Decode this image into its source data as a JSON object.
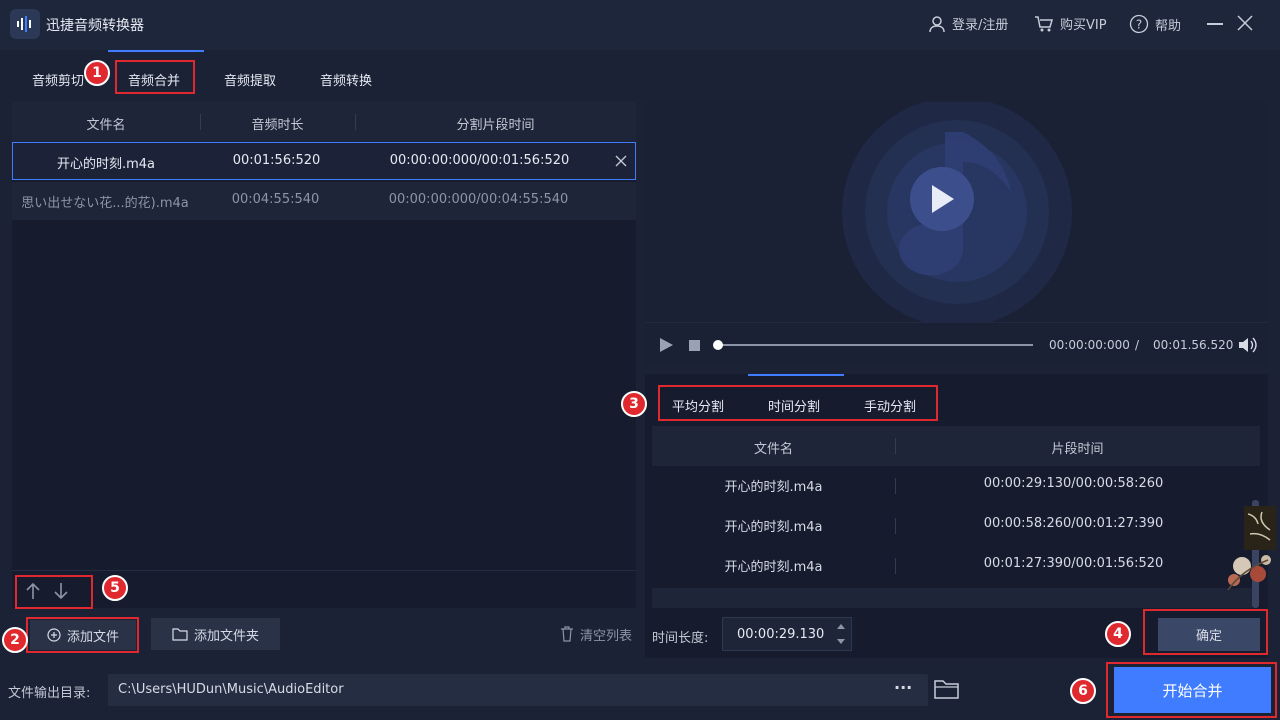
{
  "app": {
    "title": "迅捷音频转换器"
  },
  "titlebar": {
    "login": "登录/注册",
    "vip": "购买VIP",
    "help": "帮助"
  },
  "tabs": [
    "音频剪切",
    "音频合并",
    "音频提取",
    "音频转换"
  ],
  "file_table": {
    "columns": [
      "文件名",
      "音频时长",
      "分割片段时间"
    ],
    "rows": [
      {
        "name": "开心的时刻.m4a",
        "duration": "00:01:56:520",
        "range": "00:00:00:000/00:01:56:520"
      },
      {
        "name": "思い出せない花...的花).m4a",
        "duration": "00:04:55:540",
        "range": "00:00:00:000/00:04:55:540"
      }
    ]
  },
  "left_buttons": {
    "add_file": "添加文件",
    "add_folder": "添加文件夹",
    "clear_list": "清空列表"
  },
  "player": {
    "current_time": "00:00:00:000",
    "separator": "/",
    "total_time": "00:01.56.520"
  },
  "split_tabs": [
    "平均分割",
    "时间分割",
    "手动分割"
  ],
  "split_table": {
    "columns": [
      "文件名",
      "片段时间"
    ],
    "rows": [
      {
        "name": "开心的时刻.m4a",
        "time": "00:00:29:130/00:00:58:260"
      },
      {
        "name": "开心的时刻.m4a",
        "time": "00:00:58:260/00:01:27:390"
      },
      {
        "name": "开心的时刻.m4a",
        "time": "00:01:27:390/00:01:56:520"
      }
    ]
  },
  "duration_field": {
    "label": "时间长度:",
    "value": "00:00:29.130"
  },
  "confirm_button": "确定",
  "output": {
    "label": "文件输出目录:",
    "path": "C:\\Users\\HUDun\\Music\\AudioEditor",
    "more": "···"
  },
  "start_button": "开始合并",
  "annotations": [
    "1",
    "2",
    "3",
    "4",
    "5",
    "6"
  ],
  "colors": {
    "accent": "#3f7cff",
    "annotation": "#e0292f",
    "background": "#1b2236"
  }
}
